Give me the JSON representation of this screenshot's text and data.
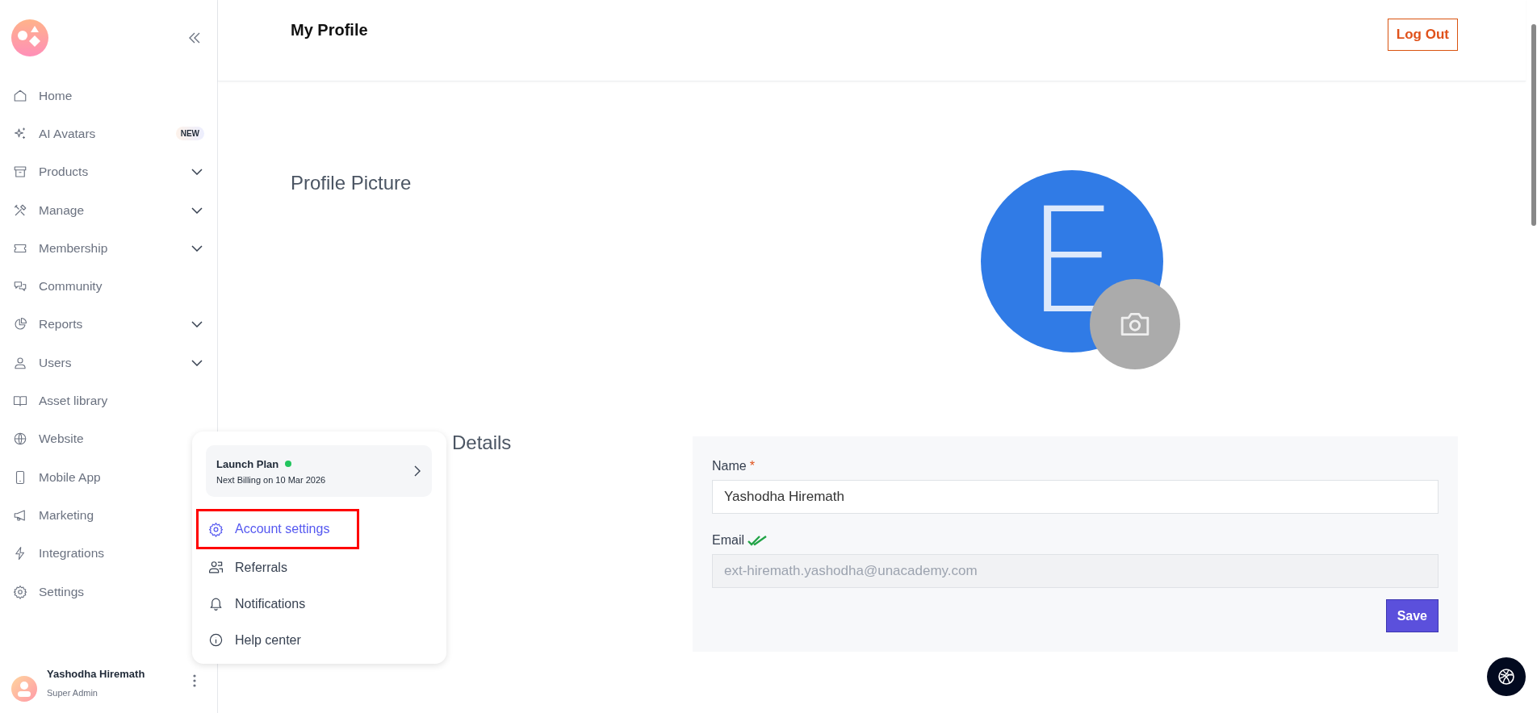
{
  "sidebar": {
    "nav": [
      {
        "label": "Home",
        "expandable": false
      },
      {
        "label": "AI Avatars",
        "expandable": false,
        "badge": "NEW"
      },
      {
        "label": "Products",
        "expandable": true
      },
      {
        "label": "Manage",
        "expandable": true
      },
      {
        "label": "Membership",
        "expandable": true
      },
      {
        "label": "Community",
        "expandable": false
      },
      {
        "label": "Reports",
        "expandable": true
      },
      {
        "label": "Users",
        "expandable": true
      },
      {
        "label": "Asset library",
        "expandable": false
      },
      {
        "label": "Website",
        "expandable": false
      },
      {
        "label": "Mobile App"
      },
      {
        "label": "Marketing"
      },
      {
        "label": "Integrations"
      },
      {
        "label": "Settings"
      }
    ],
    "user": {
      "name": "Yashodha Hiremath",
      "role": "Super Admin"
    }
  },
  "popup": {
    "plan": {
      "name": "Launch Plan",
      "active": true,
      "billing": "Next Billing on 10 Mar 2026"
    },
    "items": [
      {
        "label": "Account settings",
        "selected": true
      },
      {
        "label": "Referrals",
        "selected": false
      },
      {
        "label": "Notifications",
        "selected": false
      },
      {
        "label": "Help center",
        "selected": false
      }
    ]
  },
  "header": {
    "title": "My Profile",
    "logout": "Log Out"
  },
  "profile_picture": {
    "heading": "Profile Picture",
    "initial": "E"
  },
  "details": {
    "heading": "Details",
    "name": {
      "label": "Name",
      "required_mark": "*",
      "value": "Yashodha Hiremath"
    },
    "email": {
      "label": "Email",
      "verified": true,
      "value": "ext-hiremath.yashodha@unacademy.com",
      "disabled": true
    },
    "save": "Save"
  }
}
